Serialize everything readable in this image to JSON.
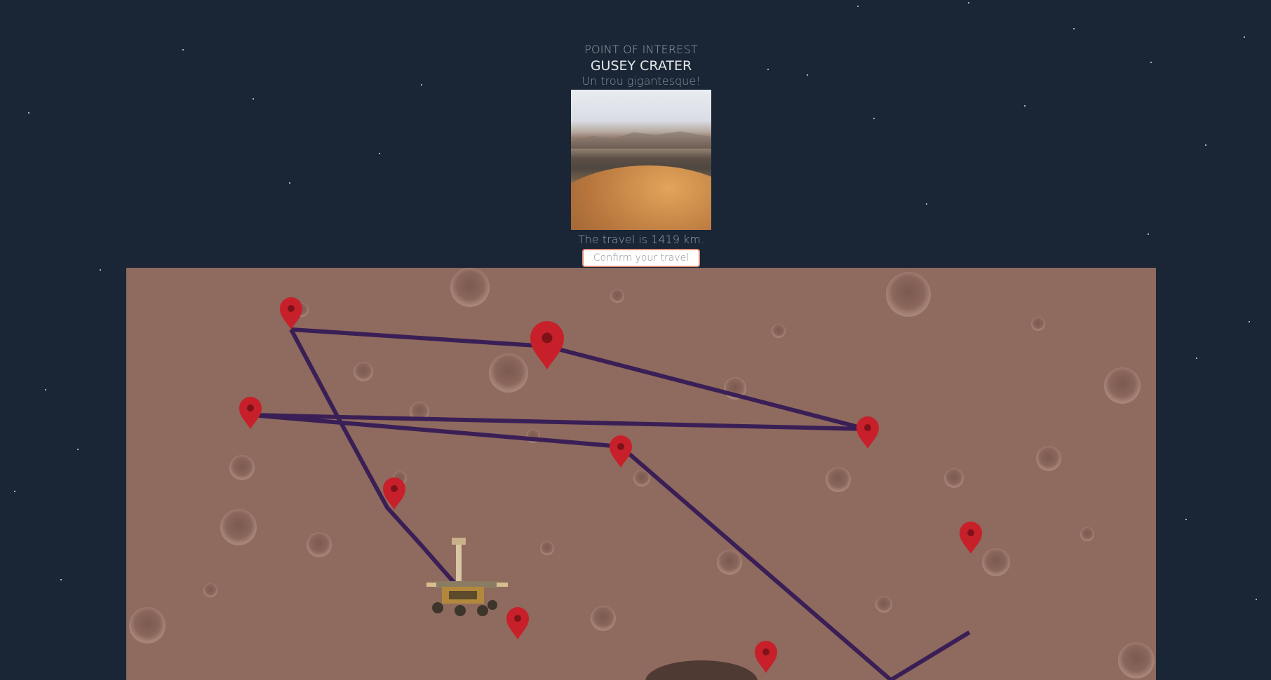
{
  "poi": {
    "kicker": "POINT OF INTEREST",
    "title": "GUSEY CRATER",
    "subtitle": "Un trou gigantesque!",
    "photo_alt": "Crater photo",
    "distance_text": "The travel is 1419 km.",
    "confirm_label": "Confirm your travel"
  },
  "map": {
    "marker_color": "#c8202a",
    "route_color": "#3a1f56",
    "surface_color": "#8f6a5e",
    "markers": [
      {
        "id": "pin-1"
      },
      {
        "id": "pin-2"
      },
      {
        "id": "pin-3"
      },
      {
        "id": "pin-4"
      },
      {
        "id": "pin-5"
      },
      {
        "id": "pin-6"
      },
      {
        "id": "pin-7"
      },
      {
        "id": "pin-8"
      },
      {
        "id": "pin-9"
      },
      {
        "id": "pin-10"
      }
    ],
    "rover": "rover-icon"
  },
  "colors": {
    "background": "#1a2535",
    "accent_border": "#e48f7a"
  }
}
